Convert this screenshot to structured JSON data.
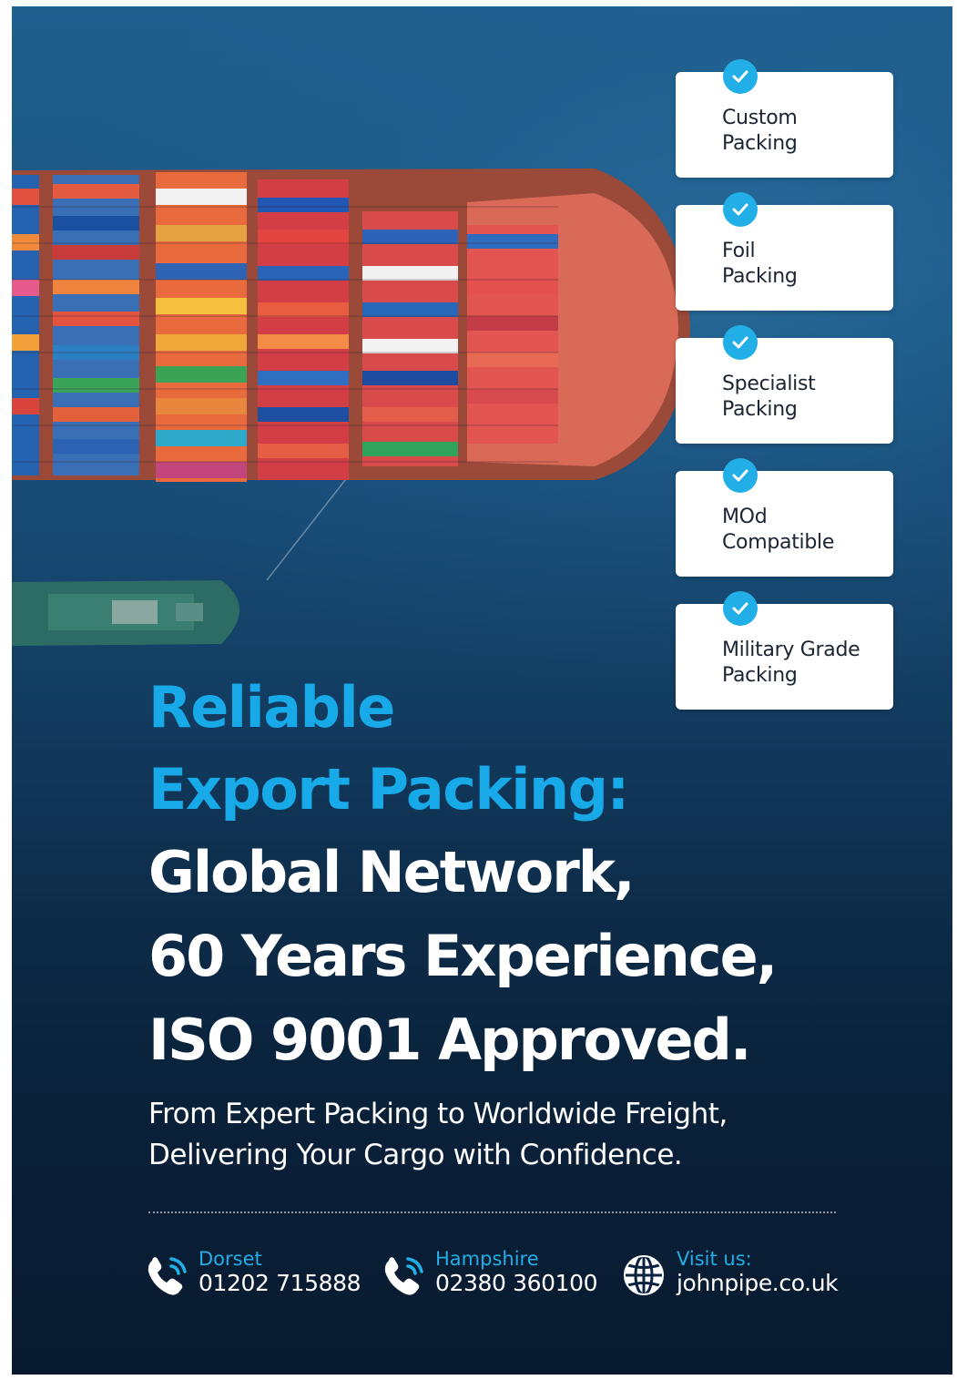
{
  "features": [
    {
      "line1": "Custom",
      "line2": "Packing"
    },
    {
      "line1": "Foil",
      "line2": "Packing"
    },
    {
      "line1": "Specialist",
      "line2": "Packing"
    },
    {
      "line1": "MOd",
      "line2": "Compatible"
    },
    {
      "line1": "Military Grade",
      "line2": "Packing"
    }
  ],
  "headline": {
    "blue_line1": "Reliable",
    "blue_line2": "Export Packing:",
    "white_line1": "Global Network,",
    "white_line2": "60 Years Experience,",
    "white_line3": "ISO 9001 Approved."
  },
  "subheadline": {
    "line1": "From Expert Packing to Worldwide Freight,",
    "line2": "Delivering Your Cargo with Confidence."
  },
  "contacts": [
    {
      "label": "Dorset",
      "value": "01202 715888",
      "icon": "phone-icon"
    },
    {
      "label": "Hampshire",
      "value": "02380 360100",
      "icon": "phone-icon"
    },
    {
      "label": "Visit us:",
      "value": "johnpipe.co.uk",
      "icon": "globe-icon"
    }
  ],
  "colors": {
    "accent": "#17a9e8",
    "background": "#0a213a",
    "card": "#ffffff"
  }
}
